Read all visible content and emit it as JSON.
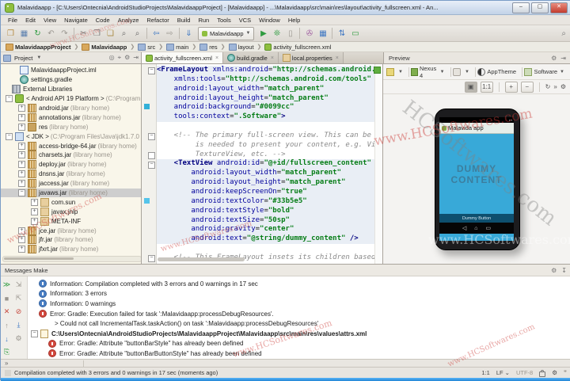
{
  "window": {
    "title": "Malavidaapp - [C:\\Users\\Ontecnia\\AndroidStudioProjects\\MalavidaappProject] - [Malavidaapp] - ...\\Malavidaapp\\src\\main\\res\\layout\\activity_fullscreen.xml - An...",
    "min": "–",
    "max": "▢",
    "close": "✕"
  },
  "menu": {
    "items": [
      "File",
      "Edit",
      "View",
      "Navigate",
      "Code",
      "Analyze",
      "Refactor",
      "Build",
      "Run",
      "Tools",
      "VCS",
      "Window",
      "Help"
    ]
  },
  "toolbar": {
    "open": "❒",
    "save": "▦",
    "sync": "↻",
    "undo": "↶",
    "redo": "↷",
    "cut": "✂",
    "copy": "❐",
    "paste": "❏",
    "find": "⌕",
    "replace": "⌕",
    "back": "⇦",
    "forward": "⇨",
    "make": "⇓",
    "run_config": "Malavidaapp",
    "run": "▶",
    "debug": "❊",
    "attach": "▯",
    "ninepatch": "✇",
    "avd": "▦",
    "gradle_sync": "⇅",
    "monitor": "▭",
    "search": "⌕"
  },
  "breadcrumb": {
    "items": [
      "MalavidaappProject",
      "Malavidaapp",
      "src",
      "main",
      "res",
      "layout",
      "activity_fullscreen.xml"
    ],
    "sep": "❯"
  },
  "project": {
    "header": "Project",
    "tree": [
      {
        "exp": "",
        "label": "MalavidaappProject.iml",
        "suffix": ""
      },
      {
        "exp": "",
        "label": "settings.gradle",
        "suffix": ""
      },
      {
        "exp": "",
        "label": "External Libraries",
        "suffix": ""
      },
      {
        "exp": "−",
        "label": "< Android API 19 Platform >",
        "suffix": " (C:\\Program"
      },
      {
        "exp": "+",
        "label": "android.jar",
        "suffix": " (library home)"
      },
      {
        "exp": "+",
        "label": "annotations.jar",
        "suffix": " (library home)"
      },
      {
        "exp": "+",
        "label": "res",
        "suffix": " (library home)"
      },
      {
        "exp": "−",
        "label": "< JDK >",
        "suffix": " (C:\\Program Files\\Java\\jdk1.7.0"
      },
      {
        "exp": "+",
        "label": "access-bridge-64.jar",
        "suffix": " (library home)"
      },
      {
        "exp": "+",
        "label": "charsets.jar",
        "suffix": " (library home)"
      },
      {
        "exp": "+",
        "label": "deploy.jar",
        "suffix": " (library home)"
      },
      {
        "exp": "+",
        "label": "dnsns.jar",
        "suffix": " (library home)"
      },
      {
        "exp": "+",
        "label": "jaccess.jar",
        "suffix": " (library home)"
      },
      {
        "exp": "−",
        "label": "javaws.jar",
        "suffix": " (library home)"
      },
      {
        "exp": "+",
        "label": "com.sun",
        "suffix": ""
      },
      {
        "exp": "+",
        "label": "javax.jnlp",
        "suffix": ""
      },
      {
        "exp": "+",
        "label": "META-INF",
        "suffix": ""
      },
      {
        "exp": "+",
        "label": "jce.jar",
        "suffix": " (library home)"
      },
      {
        "exp": "+",
        "label": "jfr.jar",
        "suffix": " (library home)"
      },
      {
        "exp": "+",
        "label": "jfxrt.jar",
        "suffix": " (library home)"
      }
    ]
  },
  "tabs": [
    {
      "label": "activity_fullscreen.xml",
      "close": "×"
    },
    {
      "label": "build.gradle",
      "close": "×"
    },
    {
      "label": "local.properties",
      "close": "×"
    }
  ],
  "editor": {
    "lines": [
      {
        "t": "<FrameLayout",
        "a": " xmlns:android",
        "p": "=",
        "s": "\"http://schemas.android.c"
      },
      {
        "a": "    xmlns:tools",
        "p": "=",
        "s": "\"http://schemas.android.com/tools\""
      },
      {
        "a": "    android:layout_width",
        "p": "=",
        "s": "\"match_parent\""
      },
      {
        "a": "    android:layout_height",
        "p": "=",
        "s": "\"match_parent\""
      },
      {
        "a": "    android:background",
        "p": "=",
        "s": "\"#0099cc\""
      },
      {
        "a": "    tools:context",
        "p": "=",
        "s": "\".Software\"",
        "e": ">"
      },
      {},
      {
        "c": "    <!-- The primary full-screen view. This can be r"
      },
      {
        "c": "         is needed to present your content, e.g. Vid"
      },
      {
        "c": "         TextureView, etc. -->"
      },
      {
        "t": "    <TextView",
        "a": " android:id",
        "p": "=",
        "s": "\"@+id/fullscreen_content\""
      },
      {
        "a": "        android:layout_width",
        "p": "=",
        "s": "\"match_parent\""
      },
      {
        "a": "        android:layout_height",
        "p": "=",
        "s": "\"match_parent\""
      },
      {
        "a": "        android:keepScreenOn",
        "p": "=",
        "s": "\"true\""
      },
      {
        "a": "        android:textColor",
        "p": "=",
        "s": "\"#33b5e5\""
      },
      {
        "a": "        android:textStyle",
        "p": "=",
        "s": "\"bold\""
      },
      {
        "a": "        android:textSize",
        "p": "=",
        "s": "\"50sp\""
      },
      {
        "a": "        android:gravity",
        "p": "=",
        "s": "\"center\""
      },
      {
        "a": "        android:text",
        "p": "=",
        "s": "\"@string/dummy_content\"",
        "e": " />"
      },
      {},
      {
        "c": "    <!-- This FrameLayout insets its children based"
      }
    ],
    "colors": {
      "background_value": "#0099cc",
      "text_color_value": "#33b5e5"
    }
  },
  "preview": {
    "title": "Preview",
    "device": "Nexus 4",
    "theme": "AppTheme",
    "activity": "Software",
    "caret": "▾",
    "phone": {
      "app_title": "Malavida app",
      "content_line1": "DUMMY",
      "content_line2": "CONTENT",
      "button": "Dummy Button",
      "nav_back": "◁",
      "nav_home": "⌂",
      "nav_recents": "▭"
    }
  },
  "messages": {
    "title": "Messages Make",
    "rows": [
      {
        "text": "Information: Compilation completed with 3 errors and 0 warnings in 17 sec"
      },
      {
        "text": "Information: 3 errors"
      },
      {
        "text": "Information: 0 warnings"
      },
      {
        "text": "Error: Gradle: Execution failed for task ':Malavidaapp:processDebugResources'."
      },
      {
        "text": "> Could not call IncrementalTask.taskAction() on task ':Malavidaapp:processDebugResources'"
      },
      {
        "exp": "−",
        "text": "C:\\Users\\Ontecnia\\AndroidStudioProjects\\MalavidaappProject\\Malavidaapp\\src\\main\\res\\values\\attrs.xml"
      },
      {
        "text": "Error: Gradle: Attribute \"buttonBarStyle\" has already been defined"
      },
      {
        "text": "Error: Gradle: Attribute \"buttonBarButtonStyle\" has already been defined"
      }
    ]
  },
  "bottom": {
    "more": "»"
  },
  "status": {
    "text": "Compilation completed with 3 errors and 0 warnings in 17 sec (moments ago)",
    "position": "1:1",
    "line_sep": "LF ⌄",
    "encoding": "UTF-8"
  },
  "watermark": "www.HCSoftwares.com",
  "watermark_big": "HCSoftwares.com"
}
